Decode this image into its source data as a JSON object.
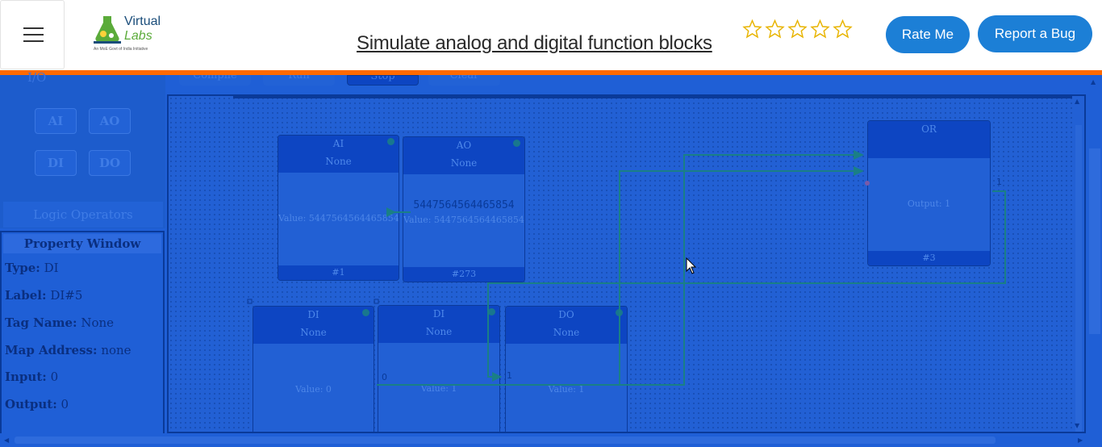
{
  "header": {
    "logo_line1": "Virtual",
    "logo_line2": "Labs",
    "logo_sub": "An MoE Govt of India Initiative",
    "title": "Simulate analog and digital function blocks",
    "rate_label": "Rate Me",
    "bug_label": "Report a Bug",
    "rating": {
      "value": 0,
      "max": 5
    }
  },
  "toolbar": {
    "compile": "Compile",
    "run": "Run",
    "stop": "Stop",
    "clear": "Clear"
  },
  "sidebar": {
    "section": "I/O",
    "io": [
      "AI",
      "AO",
      "DI",
      "DO"
    ],
    "logic": "Logic Operators"
  },
  "properties": {
    "title": "Property Window",
    "type_label": "Type:",
    "type": "DI",
    "label_label": "Label:",
    "label": "DI#5",
    "tag_label": "Tag Name:",
    "tag": "None",
    "map_label": "Map Address:",
    "map": "none",
    "input_label": "Input:",
    "input": "0",
    "output_label": "Output:",
    "output": "0"
  },
  "blocks": {
    "ai": {
      "type": "AI",
      "tag": "None",
      "value": "Value: 5447564564465854",
      "id": "#1"
    },
    "ao": {
      "type": "AO",
      "tag": "None",
      "big": "5447564564465854",
      "value": "Value: 5447564564465854",
      "id": "#273"
    },
    "or": {
      "type": "OR",
      "output": "Output: 1",
      "id": "#3",
      "port_label": "1"
    },
    "di1": {
      "type": "DI",
      "tag": "None",
      "value": "Value: 0"
    },
    "di2": {
      "type": "DI",
      "tag": "None",
      "value": "Value: 1",
      "port_label": "0"
    },
    "do": {
      "type": "DO",
      "tag": "None",
      "value": "Value: 1",
      "port_label": "1"
    }
  },
  "colors": {
    "accent": "#1c7fd6",
    "orange": "#ff6a00",
    "overlay": "#1f5fd6",
    "wire": "#1a7f86"
  }
}
